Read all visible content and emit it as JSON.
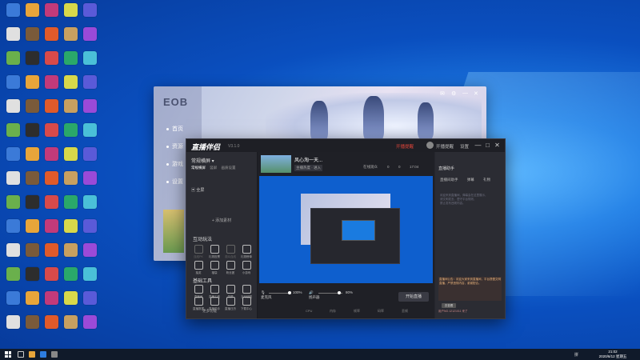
{
  "desktop": {
    "icon_labels": [
      "",
      "",
      "",
      "",
      "",
      "",
      "",
      "",
      "",
      "",
      "",
      "",
      "",
      "",
      "",
      "",
      "",
      "",
      "",
      "",
      "",
      "",
      "",
      "",
      "",
      "",
      "",
      "",
      "",
      "",
      "",
      "",
      "",
      "",
      "",
      "",
      "",
      "",
      "",
      "",
      "",
      "",
      "",
      "",
      "",
      "",
      "",
      "",
      "",
      "",
      "",
      "",
      "",
      "",
      "",
      "",
      "",
      "",
      "",
      "",
      "",
      "",
      "",
      "",
      "",
      "",
      "",
      "",
      "",
      ""
    ]
  },
  "launcher": {
    "logo_text": "EOB",
    "nav": [
      "首页",
      "资源",
      "游戏",
      "设置"
    ],
    "controls": [
      "✉",
      "⚙",
      "—",
      "✕"
    ]
  },
  "app": {
    "brand": "直播伴侣",
    "version": "V3.1.0",
    "titlebar": {
      "live_status": "开播提醒",
      "item1": "开播提醒",
      "item2": "设置",
      "win_controls": [
        "—",
        "□",
        "✕"
      ]
    },
    "left": {
      "scene": "常规横屏 ▾",
      "tabs": [
        "常规横屏",
        "竖屏",
        "画质设置"
      ],
      "active_tab": "常规横屏",
      "source": "全屏",
      "add_source": "+ 添加素材",
      "interact_title": "互动玩法",
      "interact_tools": [
        {
          "label": "连线PK",
          "enabled": false
        },
        {
          "label": "礼物投票",
          "enabled": true
        },
        {
          "label": "观众连线",
          "enabled": false
        },
        {
          "label": "礼物榜单",
          "enabled": true
        },
        {
          "label": "抽奖",
          "enabled": true
        },
        {
          "label": "福袋",
          "enabled": true
        },
        {
          "label": "粉丝团",
          "enabled": true
        },
        {
          "label": "小游戏",
          "enabled": true
        }
      ],
      "basic_title": "基础工具",
      "basic_tools": [
        "直播间",
        "直播工具",
        "录屏",
        "互动贴图",
        "直播数据",
        "直播助手",
        "直播日历",
        "下载中心"
      ],
      "more": "更多功能"
    },
    "center": {
      "stream_title": "风心淘一天...",
      "stream_sub": "主播热度 · 进入",
      "meta": [
        "在线观众",
        "0",
        "0",
        "17:04"
      ],
      "mic_label": "麦克风",
      "mic_pct": "100%",
      "speaker_label": "扬声器",
      "speaker_pct": "80%",
      "go_live": "开始直播",
      "status": [
        "CPU",
        "内存",
        "帧率",
        "码率",
        "丢帧"
      ]
    },
    "right": {
      "title": "直播助手",
      "tabs": [
        "直播间助手",
        "弹幕",
        "礼物"
      ],
      "chat_lines": [
        "欢迎来到直播间，弹幕会在这里展示，",
        "请文明发言，遵守平台规则，",
        "禁止发布违规内容。"
      ],
      "notice": "直播间公告：欢迎大家来到直播间，平台提倡文明直播，严禁违规内容，谢谢配合。",
      "button": "去查看",
      "user": "用户NO.12121011 来了"
    }
  },
  "taskbar": {
    "tray_lang": "拼",
    "time": "21:02",
    "date": "2020/6/12 星期五"
  },
  "colors": {
    "desktop_blue": "#0a4fbf",
    "app_bg": "#26272e",
    "accent_red": "#e0453a"
  }
}
